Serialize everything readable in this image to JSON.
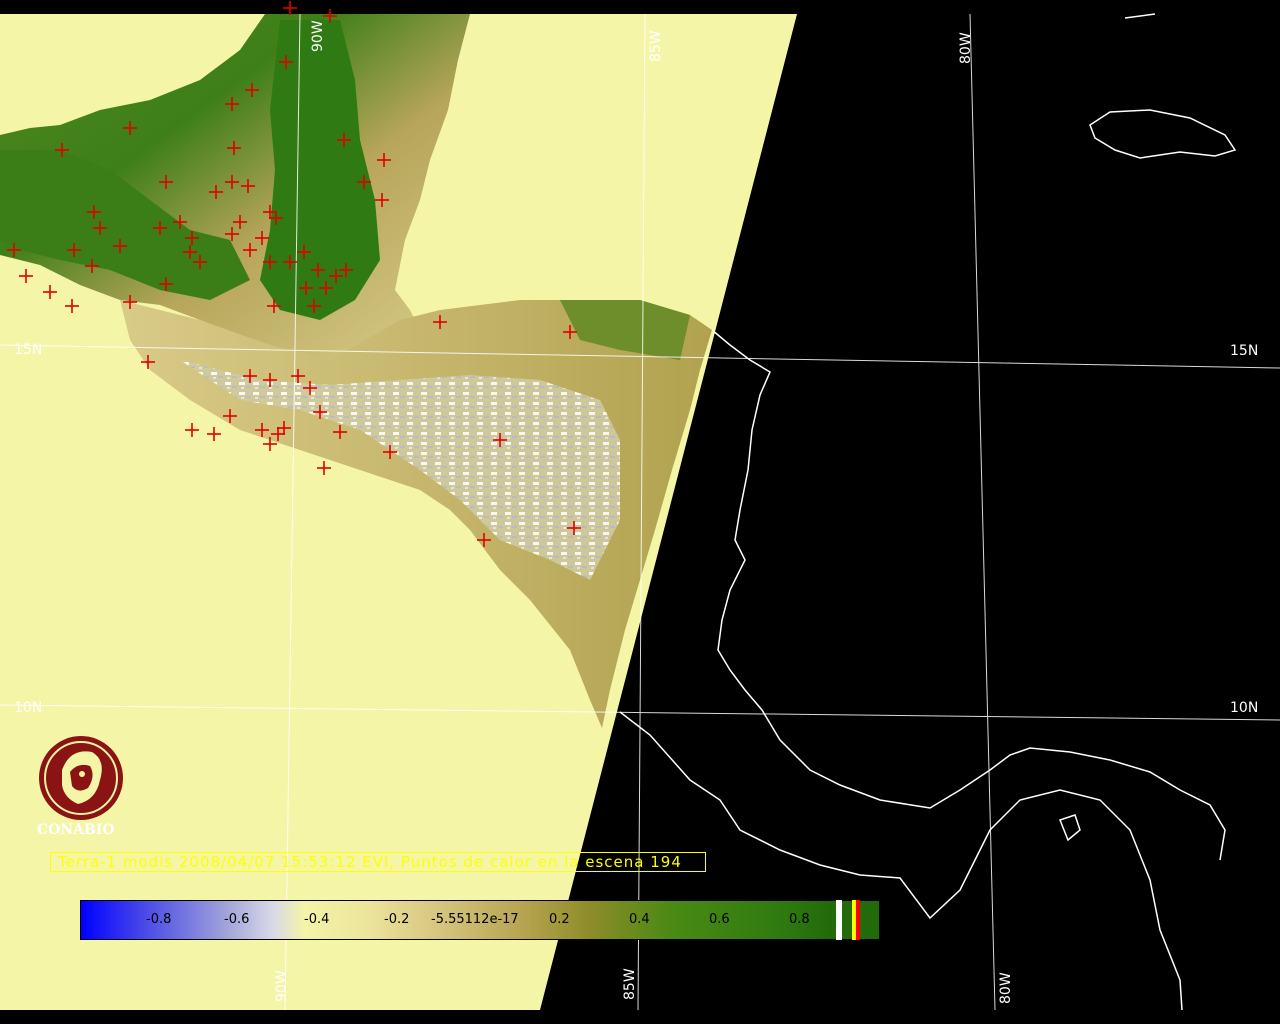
{
  "caption": "Terra-1 modis 2008/04/07 15:53:12 EVI, Puntos de calor en la escena 194",
  "logo": {
    "text": "CONABIO"
  },
  "grid": {
    "lat_labels": [
      "15N",
      "10N"
    ],
    "lon_labels": [
      "90W",
      "85W",
      "80W"
    ]
  },
  "colorbar": {
    "ticks": [
      "-0.8",
      "-0.6",
      "-0.4",
      "-0.2",
      "-5.55112e-17",
      "0.2",
      "0.4",
      "0.6",
      "0.8"
    ],
    "colors": {
      "min": "#0000ff",
      "neutral": "#f4f4a8",
      "max": "#226a0a",
      "cloud": "#ffffff",
      "fire": "#ff0000",
      "water": "#f5f5a8",
      "night": "#000000"
    }
  },
  "map": {
    "hotspot_marker": "red-cross-icon",
    "hotspot_color": "#e00000"
  }
}
